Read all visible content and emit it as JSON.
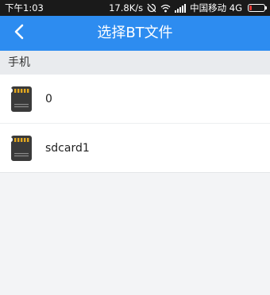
{
  "status_bar": {
    "time": "下午1:03",
    "speed": "17.8K/s",
    "carrier": "中国移动 4G"
  },
  "app_bar": {
    "title": "选择BT文件",
    "back_icon": "chevron-left-icon"
  },
  "section": {
    "title": "手机"
  },
  "files": [
    {
      "label": "0",
      "icon": "sd-card-icon"
    },
    {
      "label": "sdcard1",
      "icon": "sd-card-icon"
    }
  ],
  "colors": {
    "status_bar_bg": "#1a1a1a",
    "app_bar_bg": "#2d8cf0",
    "section_bg": "#e9ebee",
    "page_bg": "#f3f4f6",
    "battery_low": "#e53935"
  }
}
